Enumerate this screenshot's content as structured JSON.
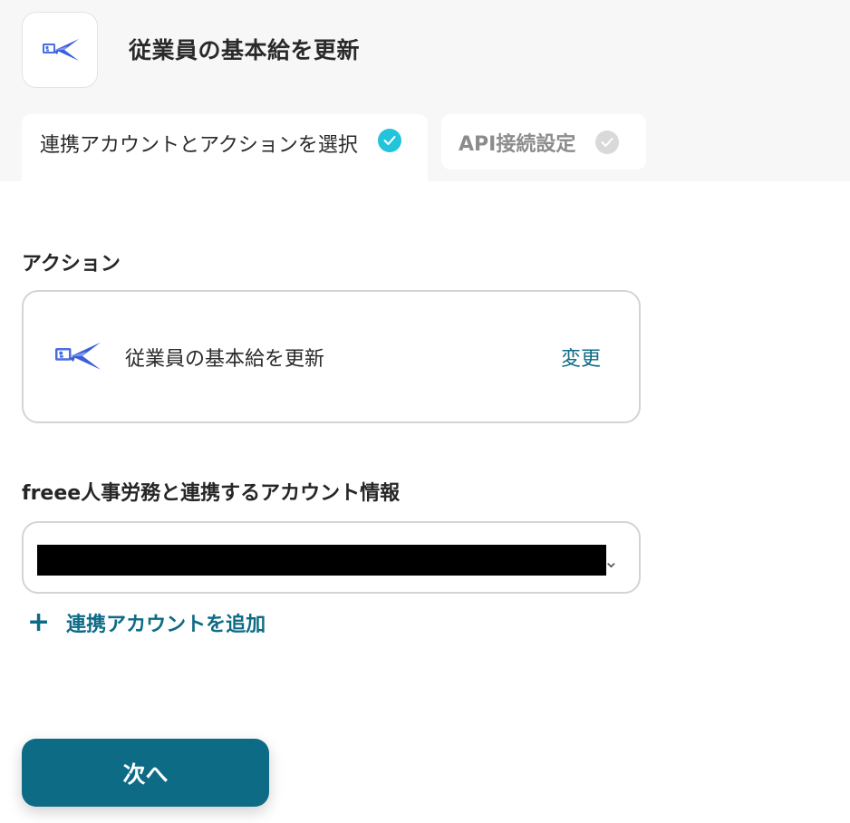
{
  "header": {
    "app_icon": "freee-hr-logo-icon",
    "title": "従業員の基本給を更新"
  },
  "tabs": [
    {
      "label": "連携アカウントとアクションを選択",
      "status": "completed",
      "icon": "check-icon"
    },
    {
      "label": "API接続設定",
      "status": "pending",
      "icon": "check-icon"
    }
  ],
  "action_section": {
    "label": "アクション",
    "action_name": "従業員の基本給を更新",
    "change_label": "変更",
    "icon": "freee-hr-logo-icon"
  },
  "account_section": {
    "label": "freee人事労務と連携するアカウント情報",
    "selected_value_redacted": true,
    "chevron_icon": "chevron-down-icon",
    "add_account_label": "連携アカウントを追加",
    "add_icon": "plus-icon"
  },
  "footer": {
    "next_label": "次へ"
  },
  "colors": {
    "accent": "#0d6b86",
    "check_active": "#22c4dc",
    "check_inactive": "#d9d9d9",
    "header_bg": "#f7f7f7"
  }
}
